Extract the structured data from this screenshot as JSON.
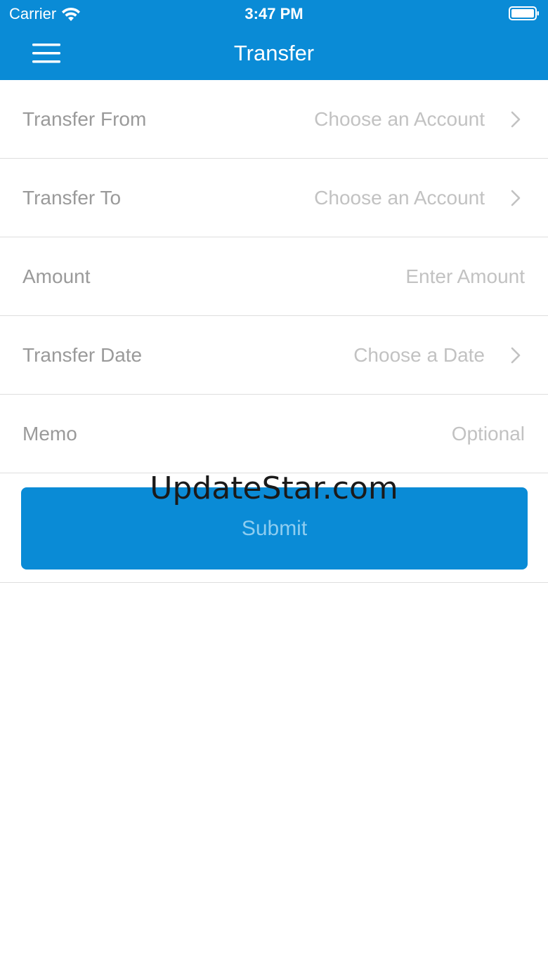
{
  "status_bar": {
    "carrier": "Carrier",
    "wifi_icon": "wifi-icon",
    "time": "3:47 PM",
    "battery_icon": "battery-icon"
  },
  "nav": {
    "menu_icon": "hamburger-menu-icon",
    "title": "Transfer"
  },
  "form": {
    "rows": [
      {
        "label": "Transfer From",
        "value": "Choose an Account",
        "has_chevron": true
      },
      {
        "label": "Transfer To",
        "value": "Choose an Account",
        "has_chevron": true
      },
      {
        "label": "Amount",
        "placeholder": "Enter Amount",
        "has_chevron": false
      },
      {
        "label": "Transfer Date",
        "value": "Choose a Date",
        "has_chevron": true
      },
      {
        "label": "Memo",
        "placeholder": "Optional",
        "has_chevron": false
      }
    ]
  },
  "submit": {
    "label": "Submit"
  },
  "watermark": {
    "text": "UpdateStar.com"
  },
  "colors": {
    "brand": "#0a8bd6",
    "label_text": "#9a9a9a",
    "placeholder_text": "#c2c2c2",
    "submit_text_disabled": "#8ecdf0",
    "divider": "#dedede"
  }
}
